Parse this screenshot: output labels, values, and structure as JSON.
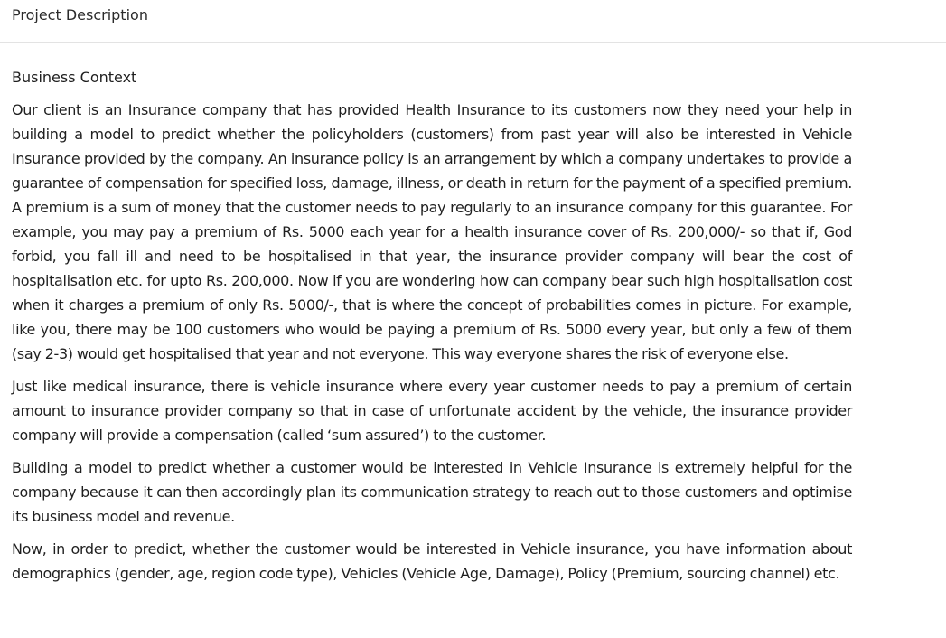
{
  "header": {
    "title": "Project Description"
  },
  "content": {
    "section_heading": "Business Context",
    "paragraphs": [
      "Our client is an Insurance company that has provided Health Insurance to its customers now they need your help in building a model to predict whether the policyholders (customers) from past year will also be interested in Vehicle Insurance provided by the company. An insurance policy is an arrangement by which a company undertakes to provide a guarantee of compensation for specified loss, damage, illness, or death in return for the payment of a specified premium. A premium is a sum of money that the customer needs to pay regularly to an insurance company for this guarantee. For example, you may pay a premium of Rs. 5000 each year for a health insurance cover of Rs. 200,000/- so that if, God forbid, you fall ill and need to be hospitalised in that year, the insurance provider company will bear the cost of hospitalisation etc. for upto Rs. 200,000. Now if you are wondering how can company bear such high hospitalisation cost when it charges a premium of only Rs. 5000/-, that is where the concept of probabilities comes in picture. For example, like you, there may be 100 customers who would be paying a premium of Rs. 5000 every year, but only a few of them (say 2-3) would get hospitalised that year and not everyone. This way everyone shares the risk of everyone else.",
      "Just like medical insurance, there is vehicle insurance where every year customer needs to pay a premium of certain amount to insurance provider company so that in case of unfortunate accident by the vehicle, the insurance provider company will provide a compensation (called ‘sum assured’) to the customer.",
      "Building a model to predict whether a customer would be interested in Vehicle Insurance is extremely helpful for the company because it can then accordingly plan its communication strategy to reach out to those customers and optimise its business model and revenue.",
      "Now, in order to predict, whether the customer would be interested in Vehicle insurance, you have information about demographics (gender, age, region code type), Vehicles (Vehicle Age, Damage), Policy (Premium, sourcing channel) etc."
    ]
  }
}
